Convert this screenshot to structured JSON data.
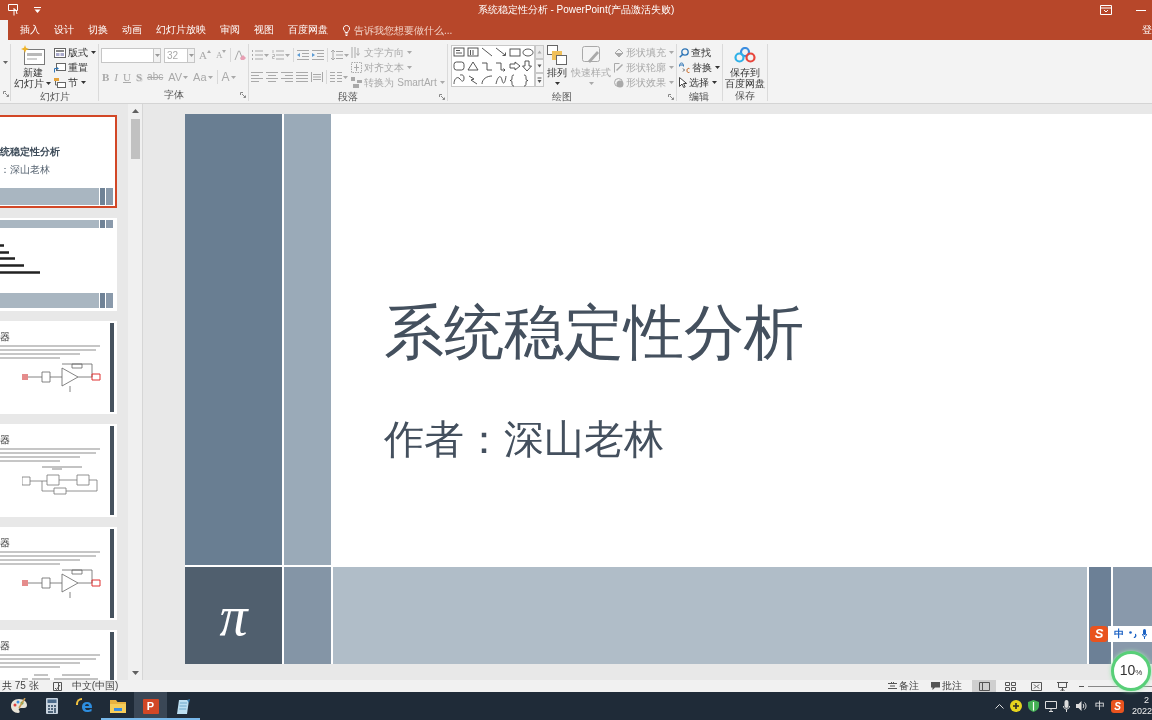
{
  "title_bar": {
    "title": "系统稳定性分析 - PowerPoint(产品激活失败)"
  },
  "ribbon_tabs": {
    "tabs": [
      {
        "label": "插入",
        "selected": false
      },
      {
        "label": "设计",
        "selected": false
      },
      {
        "label": "切换",
        "selected": false
      },
      {
        "label": "动画",
        "selected": false
      },
      {
        "label": "幻灯片放映",
        "selected": false
      },
      {
        "label": "审阅",
        "selected": false
      },
      {
        "label": "视图",
        "selected": false
      },
      {
        "label": "百度网盘",
        "selected": false
      }
    ],
    "tell_me": {
      "placeholder": "告诉我您想要做什么..."
    },
    "account": "登"
  },
  "ribbon": {
    "slides_group": {
      "label": "幻灯片",
      "disabled": false,
      "new_slide": {
        "line_1": "新建",
        "line_2": "幻灯片"
      },
      "buttons": [
        {
          "kind": "layout",
          "label": "版式",
          "dropdown": true
        },
        {
          "kind": "reset",
          "label": "重置",
          "dropdown": false
        },
        {
          "kind": "section",
          "label": "节",
          "dropdown": true
        }
      ]
    },
    "font_group": {
      "label": "字体",
      "disabled": true,
      "font_size": "32",
      "size_buttons": [
        {
          "kind": "grow",
          "label": "A"
        },
        {
          "kind": "shrink",
          "label": "A"
        }
      ],
      "format_buttons": [
        {
          "kind": "bold",
          "label": "B",
          "dropdown": false
        },
        {
          "kind": "italic",
          "label": "I",
          "dropdown": false
        },
        {
          "kind": "underline",
          "label": "U",
          "dropdown": false
        },
        {
          "kind": "shadow",
          "label": "S",
          "dropdown": false
        },
        {
          "kind": "strike",
          "label": "abc",
          "dropdown": false
        },
        {
          "kind": "spacing",
          "label": "AV",
          "dropdown": true
        },
        {
          "kind": "case",
          "label": "Aa",
          "dropdown": true
        }
      ],
      "font_color": {
        "label": "A",
        "dropdown": true
      }
    },
    "paragraph_group": {
      "label": "段落",
      "disabled": true,
      "text_buttons": [
        {
          "kind": "text-direction",
          "label": "文字方向"
        },
        {
          "kind": "align-text",
          "label": "对齐文本"
        },
        {
          "kind": "smartart",
          "label": "转换为 SmartArt"
        }
      ]
    },
    "drawing_group": {
      "label": "绘图",
      "arrange": {
        "label": "排列",
        "disabled": false
      },
      "quick_styles": {
        "label": "快速样式",
        "disabled": true
      },
      "buttons": [
        {
          "kind": "fill",
          "label": "形状填充",
          "disabled": true
        },
        {
          "kind": "outline",
          "label": "形状轮廓",
          "disabled": true
        },
        {
          "kind": "effects",
          "label": "形状效果",
          "disabled": true
        }
      ]
    },
    "editing_group": {
      "label": "编辑",
      "disabled": false,
      "buttons": [
        {
          "kind": "find",
          "label": "查找",
          "dropdown": false
        },
        {
          "kind": "replace",
          "label": "替换",
          "dropdown": true
        },
        {
          "kind": "select",
          "label": "选择",
          "dropdown": true
        }
      ]
    },
    "save_group": {
      "label": "保存",
      "line_1": "保存到",
      "line_2": "百度网盘"
    }
  },
  "thumbnails": [
    {
      "kind": "title",
      "selected": true,
      "title": "统稳定性分析",
      "subtitle": "：深山老林"
    },
    {
      "kind": "list",
      "selected": false
    },
    {
      "kind": "content",
      "selected": false,
      "heading": "器",
      "figure": {
        "kind": "circuit"
      }
    },
    {
      "kind": "content",
      "selected": false,
      "heading": "器",
      "figure": {
        "kind": "block-diagram"
      }
    },
    {
      "kind": "content",
      "selected": false,
      "heading": "器",
      "figure": {
        "kind": "circuit"
      }
    },
    {
      "kind": "content",
      "selected": false,
      "heading": "器",
      "figure": {
        "kind": "formula"
      }
    }
  ],
  "slide": {
    "title": "系统稳定性分析",
    "subtitle": "作者：深山老林",
    "logo": "π"
  },
  "status_bar": {
    "slide_count": "共 75 张",
    "language": "中文(中国)",
    "notes": "备注",
    "comments": "批注",
    "views": [
      {
        "kind": "normal",
        "selected": true
      },
      {
        "kind": "sorter",
        "selected": false
      },
      {
        "kind": "reading",
        "selected": false
      },
      {
        "kind": "slideshow",
        "selected": false
      }
    ]
  },
  "ime_toolbar": {
    "logo": "S",
    "mode": "中"
  },
  "usage_widget": {
    "value": "10",
    "unit": "%"
  },
  "taskbar": {
    "apps": [
      {
        "kind": "paint",
        "running": false,
        "active": false
      },
      {
        "kind": "calculator",
        "running": false,
        "active": false
      },
      {
        "kind": "browser",
        "glyph": "e",
        "running": false,
        "active": false
      },
      {
        "kind": "folder",
        "running": true,
        "active": false
      },
      {
        "kind": "presentation",
        "glyph": "P",
        "running": true,
        "active": true
      },
      {
        "kind": "notepad",
        "running": true,
        "active": false
      }
    ],
    "tray": {
      "input_mode": "中",
      "ime_logo": "S",
      "time": "2",
      "date": "2022"
    }
  }
}
